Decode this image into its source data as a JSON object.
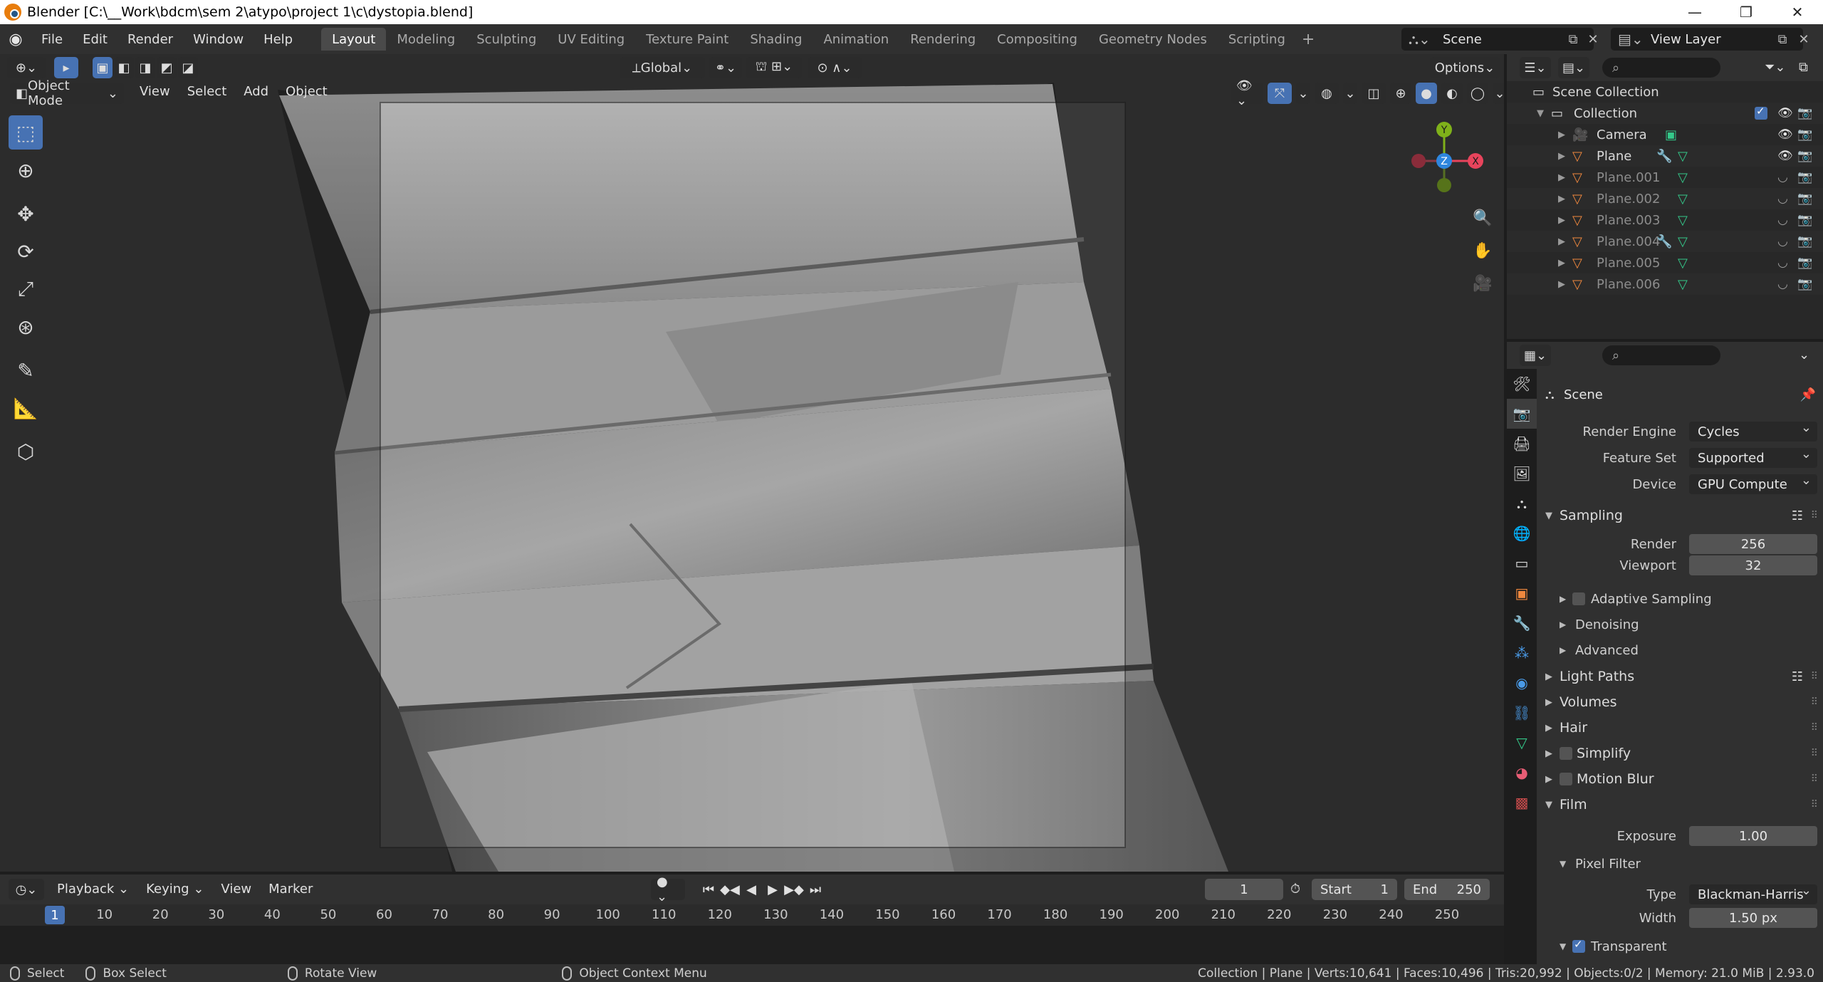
{
  "window": {
    "title": "Blender [C:\\__Work\\bdcm\\sem 2\\atypo\\project 1\\c\\dystopia.blend]"
  },
  "menubar": {
    "items": [
      "File",
      "Edit",
      "Render",
      "Window",
      "Help"
    ],
    "workspaces": [
      "Layout",
      "Modeling",
      "Sculpting",
      "UV Editing",
      "Texture Paint",
      "Shading",
      "Animation",
      "Rendering",
      "Compositing",
      "Geometry Nodes",
      "Scripting"
    ],
    "active_workspace": "Layout",
    "scene": "Scene",
    "view_layer": "View Layer"
  },
  "viewport": {
    "transform_orientation": "Global",
    "options_label": "Options",
    "mode": "Object Mode",
    "menus": [
      "View",
      "Select",
      "Add",
      "Object"
    ],
    "gizmo_axes": {
      "x": "X",
      "y": "Y",
      "z": "Z"
    },
    "colors": {
      "x": "#e8445c",
      "y": "#7fb11a",
      "z": "#2e86de",
      "select": "#4772b3"
    }
  },
  "timeline": {
    "menus": [
      "Playback",
      "Keying",
      "View",
      "Marker"
    ],
    "current_frame": "1",
    "start_label": "Start",
    "start": "1",
    "end_label": "End",
    "end": "250",
    "ticks": [
      "1",
      "10",
      "20",
      "30",
      "40",
      "50",
      "60",
      "70",
      "80",
      "90",
      "100",
      "110",
      "120",
      "130",
      "140",
      "150",
      "160",
      "170",
      "180",
      "190",
      "200",
      "210",
      "220",
      "230",
      "240",
      "250"
    ]
  },
  "statusbar": {
    "select": "Select",
    "box_select": "Box Select",
    "rotate_view": "Rotate View",
    "context_menu": "Object Context Menu",
    "stats": "Collection | Plane | Verts:10,641 | Faces:10,496 | Tris:20,992 | Objects:0/2 | Memory: 21.0 MiB | 2.93.0"
  },
  "outliner": {
    "scene_collection": "Scene Collection",
    "collection": "Collection",
    "objects": [
      {
        "name": "Camera",
        "dim": false
      },
      {
        "name": "Plane",
        "dim": false
      },
      {
        "name": "Plane.001",
        "dim": true
      },
      {
        "name": "Plane.002",
        "dim": true
      },
      {
        "name": "Plane.003",
        "dim": true
      },
      {
        "name": "Plane.004",
        "dim": true
      },
      {
        "name": "Plane.005",
        "dim": true
      },
      {
        "name": "Plane.006",
        "dim": true
      }
    ]
  },
  "properties": {
    "context": "Scene",
    "render_engine_label": "Render Engine",
    "render_engine": "Cycles",
    "feature_set_label": "Feature Set",
    "feature_set": "Supported",
    "device_label": "Device",
    "device": "GPU Compute",
    "sampling": "Sampling",
    "render_label": "Render",
    "render_samples": "256",
    "viewport_label": "Viewport",
    "viewport_samples": "32",
    "adaptive_sampling": "Adaptive Sampling",
    "denoising": "Denoising",
    "advanced": "Advanced",
    "light_paths": "Light Paths",
    "volumes": "Volumes",
    "hair": "Hair",
    "simplify": "Simplify",
    "motion_blur": "Motion Blur",
    "film": "Film",
    "exposure_label": "Exposure",
    "exposure": "1.00",
    "pixel_filter": "Pixel Filter",
    "type_label": "Type",
    "filter_type": "Blackman-Harris",
    "width_label": "Width",
    "width": "1.50 px",
    "transparent": "Transparent"
  }
}
